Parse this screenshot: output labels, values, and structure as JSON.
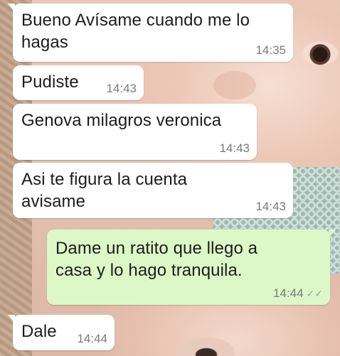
{
  "chat": {
    "wallpaper": "baby-photo",
    "colors": {
      "incoming_bubble": "#ffffff",
      "outgoing_bubble": "#dcf8c6",
      "timestamp": "#7a7a7a",
      "read_ticks": "#9aa0a6"
    },
    "messages": [
      {
        "direction": "in",
        "text": "Bueno Avísame cuando me lo\nhagas",
        "time": "14:35"
      },
      {
        "direction": "in",
        "text": "Pudiste",
        "time": "14:43"
      },
      {
        "direction": "in",
        "text": "Genova milagros veronica",
        "time": "14:43"
      },
      {
        "direction": "in",
        "text": "Asi te figura la cuenta\navisame",
        "time": "14:43"
      },
      {
        "direction": "out",
        "text": "Dame un ratito que llego a\ncasa y lo hago tranquila.",
        "time": "14:44",
        "status_icon": "double-check-icon",
        "status_glyph": "✓✓"
      },
      {
        "direction": "in",
        "text": "Dale",
        "time": "14:44"
      }
    ]
  }
}
